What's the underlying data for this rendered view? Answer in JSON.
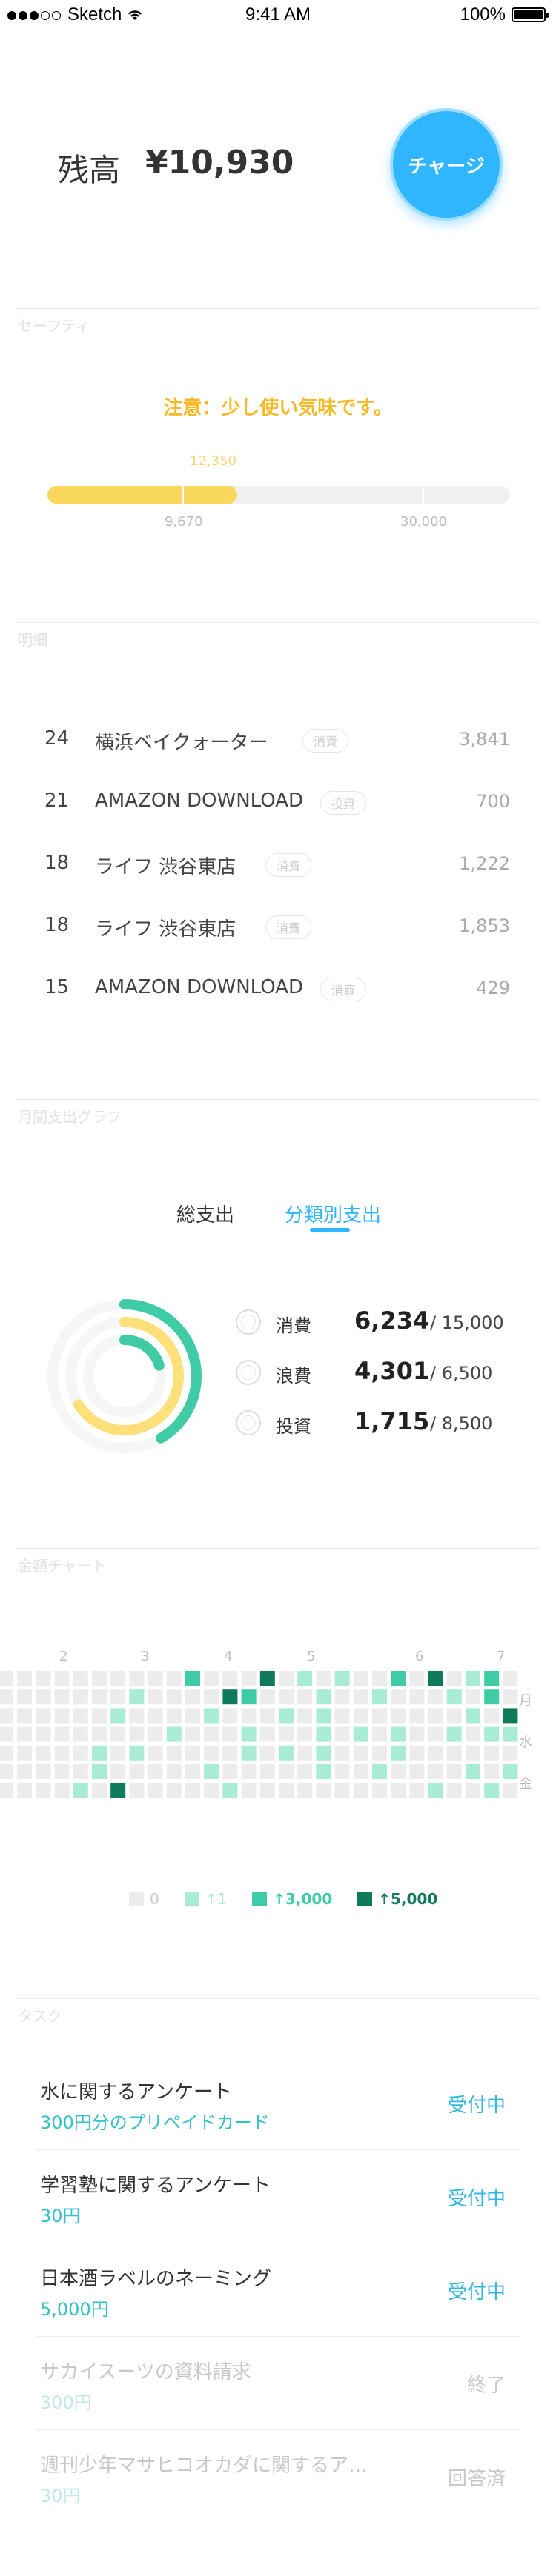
{
  "status_bar": {
    "carrier": "Sketch",
    "time": "9:41 AM",
    "battery": "100%"
  },
  "balance": {
    "label": "残高",
    "value": "¥10,930",
    "charge_label": "チャージ"
  },
  "safety": {
    "section_title": "セーフティ",
    "warning": "注意：少し使い気味です。",
    "current_label": "12,350",
    "marker_label": "9,670",
    "max_label": "30,000",
    "progress": 0.41,
    "colors": {
      "warning": "#f7b928",
      "fill": "#f9d65c"
    }
  },
  "history": {
    "section_title": "明細",
    "items": [
      {
        "day": "24",
        "name": "横浜ベイクォーター",
        "tag": "消費",
        "amount": "3,841"
      },
      {
        "day": "21",
        "name": "AMAZON DOWNLOAD",
        "tag": "投資",
        "amount": "700"
      },
      {
        "day": "18",
        "name": "ライフ 渋谷東店",
        "tag": "消費",
        "amount": "1,222"
      },
      {
        "day": "18",
        "name": "ライフ 渋谷東店",
        "tag": "消費",
        "amount": "1,853"
      },
      {
        "day": "15",
        "name": "AMAZON DOWNLOAD",
        "tag": "消費",
        "amount": "429"
      }
    ]
  },
  "monthly": {
    "section_title": "月間支出グラフ",
    "tabs": [
      {
        "label": "総支出",
        "active": false
      },
      {
        "label": "分類別支出",
        "active": true
      }
    ],
    "categories": [
      {
        "name": "消費",
        "value": "6,234",
        "max": "/ 15,000",
        "ratio": 0.4156,
        "color": "#3ecba5"
      },
      {
        "name": "浪費",
        "value": "4,301",
        "max": "/ 6,500",
        "ratio": 0.6617,
        "color": "#fde07a"
      },
      {
        "name": "投資",
        "value": "1,715",
        "max": "/ 8,500",
        "ratio": 0.2018,
        "color": "#3ecba5"
      }
    ]
  },
  "heatmap": {
    "section_title": "金額チャート",
    "month_labels": [
      "2",
      "3",
      "4",
      "5",
      "6",
      "7"
    ],
    "weekday_labels": [
      "月",
      "水",
      "金"
    ],
    "legend": [
      {
        "label": "0",
        "color": "#ececec"
      },
      {
        "label": "↑1",
        "color": "#a8ecd6"
      },
      {
        "label": "↑3,000",
        "color": "#3ecba5"
      },
      {
        "label": "↑5,000",
        "color": "#0e7a5a"
      }
    ]
  },
  "tasks": {
    "section_title": "タスク",
    "items": [
      {
        "title": "水に関するアンケート",
        "reward": "300円分のプリペイドカード",
        "status": "受付中",
        "done": false
      },
      {
        "title": "学習塾に関するアンケート",
        "reward": "30円",
        "status": "受付中",
        "done": false
      },
      {
        "title": "日本酒ラベルのネーミング",
        "reward": "5,000円",
        "status": "受付中",
        "done": false
      },
      {
        "title": "サカイスーツの資料請求",
        "reward": "300円",
        "status": "終了",
        "done": true
      },
      {
        "title": "週刊少年マサヒコオカダに関するア…",
        "reward": "30円",
        "status": "回答済",
        "done": true
      }
    ]
  }
}
